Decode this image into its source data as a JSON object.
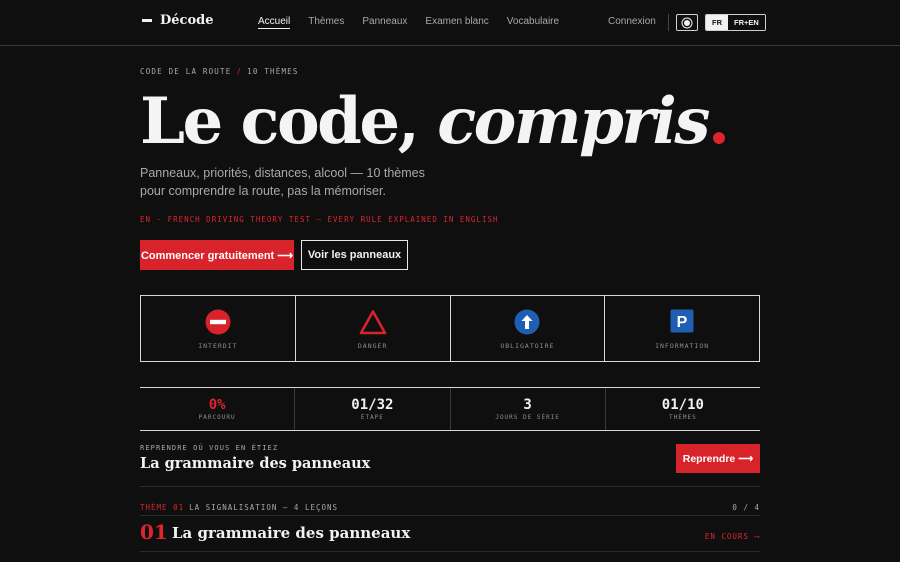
{
  "nav": {
    "brand": "Décode",
    "links": [
      {
        "label": "Accueil",
        "active": true
      },
      {
        "label": "Thèmes",
        "active": false
      },
      {
        "label": "Panneaux",
        "active": false
      },
      {
        "label": "Examen blanc",
        "active": false
      },
      {
        "label": "Vocabulaire",
        "active": false
      }
    ],
    "login": "Connexion",
    "theme_toggle_icon": "sun-icon",
    "lang_options": [
      {
        "label": "FR",
        "selected": true
      },
      {
        "label": "FR+EN",
        "selected": false
      }
    ]
  },
  "hero": {
    "kicker_left": "CODE DE LA ROUTE",
    "kicker_sep": "/",
    "kicker_right": "10 THÈMES",
    "title_a": "Le code, ",
    "title_b": "compris",
    "title_dot": ".",
    "lead": "Panneaux, priorités, distances, alcool — 10 thèmes pour comprendre la route, pas la mémoriser.",
    "en_line": "EN · FRENCH DRIVING THEORY TEST — EVERY RULE EXPLAINED IN ENGLISH",
    "cta_primary": "Commencer gratuitement ⟶",
    "cta_secondary": "Voir les panneaux"
  },
  "signs": [
    {
      "label": "INTERDIT",
      "icon": "no-entry-sign-icon",
      "color": "#d8232b"
    },
    {
      "label": "DANGER",
      "icon": "danger-triangle-icon",
      "color": "#d8232b"
    },
    {
      "label": "OBLIGATOIRE",
      "icon": "mandatory-arrow-icon",
      "color": "#1f5fb3"
    },
    {
      "label": "INFORMATION",
      "icon": "parking-sign-icon",
      "color": "#1f5fb3",
      "glyph": "P"
    }
  ],
  "stats": [
    {
      "value": "0%",
      "label": "PARCOURU",
      "accent": true
    },
    {
      "value": "01/32",
      "label": "ÉTAPE",
      "accent": false
    },
    {
      "value": "3",
      "label": "JOURS DE SÉRIE",
      "accent": false
    },
    {
      "value": "01/10",
      "label": "THÈMES",
      "accent": false
    }
  ],
  "resume": {
    "kicker": "REPRENDRE OÙ VOUS EN ÉTIEZ",
    "title": "La grammaire des panneaux",
    "button": "Reprendre ⟶"
  },
  "theme": {
    "tag": "THÈME 01",
    "heading": "LA SIGNALISATION — 4 LEÇONS",
    "count": "0 / 4",
    "number": "01",
    "title": "La grammaire des panneaux",
    "status": "EN COURS ⟶"
  },
  "colors": {
    "accent": "#d8232b",
    "blue": "#1f5fb3",
    "background": "#0f0f0f"
  }
}
